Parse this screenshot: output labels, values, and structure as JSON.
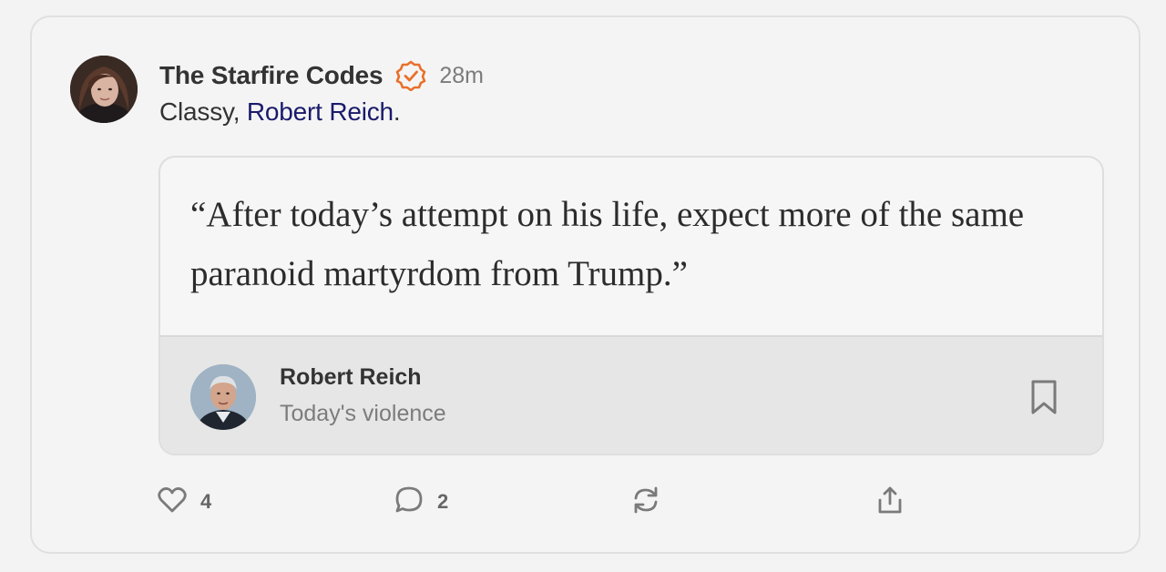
{
  "post": {
    "author": "The Starfire Codes",
    "timestamp": "28m",
    "text_prefix": "Classy, ",
    "mention": "Robert Reich",
    "text_suffix": "."
  },
  "embed": {
    "quote": "“After today’s attempt on his life, expect more of the same paranoid martyrdom from Trump.”",
    "author": "Robert Reich",
    "title": "Today's violence"
  },
  "actions": {
    "likes": "4",
    "comments": "2"
  },
  "colors": {
    "verified": "#e8702a",
    "mention": "#1a1a6b",
    "icon": "#7a7a7a"
  },
  "icons": [
    "verified-badge-icon",
    "bookmark-icon",
    "heart-icon",
    "comment-icon",
    "restack-icon",
    "share-icon"
  ]
}
